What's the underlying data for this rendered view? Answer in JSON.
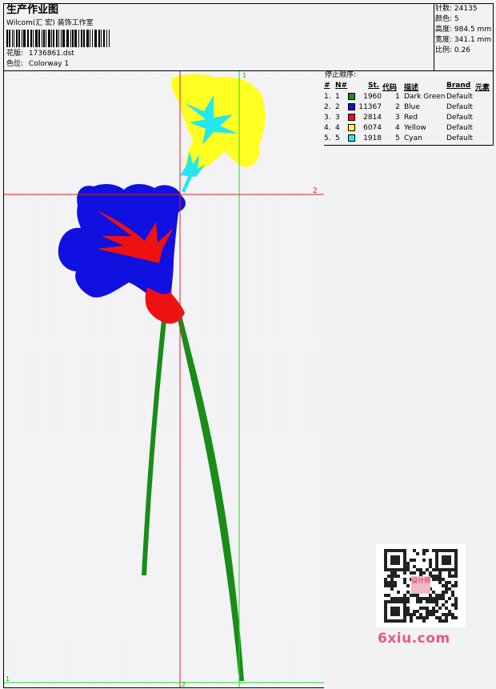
{
  "header": {
    "title": "生产作业图",
    "company": "Wilcom(汇 宏) 装饰工作室",
    "design_label": "花版:",
    "design_name": "1736861.dst",
    "colorway_label": "色位:",
    "colorway": "Colorway 1"
  },
  "stats": {
    "stitches_label": "针数:",
    "stitches": "24135",
    "colors_label": "颜色:",
    "colors": "5",
    "height_label": "高度:",
    "height": "984.5 mm",
    "width_label": "宽度:",
    "width": "341.1 mm",
    "scale_label": "比例:",
    "scale": "0.26"
  },
  "stop_sequence": {
    "title": "停止顺序:",
    "columns": [
      "#",
      "N#",
      "St.",
      "代码",
      "描述",
      "Brand",
      "元素"
    ],
    "rows": [
      {
        "num": "1.",
        "n": "1",
        "color": "#1a8c1a",
        "st": "1960",
        "code": "1",
        "desc": "Dark Green",
        "brand": "Default"
      },
      {
        "num": "2.",
        "n": "2",
        "color": "#1010e0",
        "st": "11367",
        "code": "2",
        "desc": "Blue",
        "brand": "Default"
      },
      {
        "num": "3.",
        "n": "3",
        "color": "#ee1111",
        "st": "2814",
        "code": "3",
        "desc": "Red",
        "brand": "Default"
      },
      {
        "num": "4.",
        "n": "4",
        "color": "#ffff22",
        "st": "6074",
        "code": "4",
        "desc": "Yellow",
        "brand": "Default"
      },
      {
        "num": "5.",
        "n": "5",
        "color": "#22e8ee",
        "st": "1918",
        "code": "5",
        "desc": "Cyan",
        "brand": "Default"
      }
    ]
  },
  "guides": {
    "v1_label": "1",
    "h2_label": "2",
    "h1_label": "1",
    "v2_label": "2"
  },
  "colors": {
    "green": "#1a8c1a",
    "blue": "#1010e0",
    "red": "#ee1111",
    "yellow": "#ffff22",
    "cyan": "#22e8ee",
    "guide_green": "#22dd22",
    "guide_red": "#dd2222"
  },
  "watermark": {
    "qr_badge": "设计师",
    "site": "6xiu.com"
  }
}
